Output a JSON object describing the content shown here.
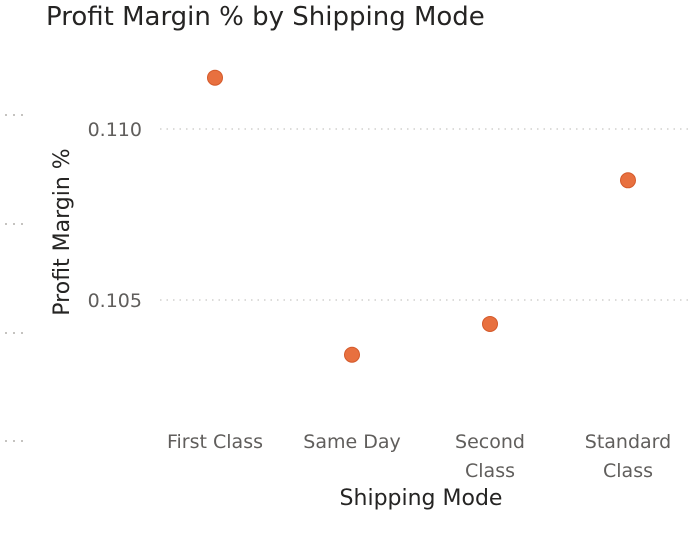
{
  "chart_data": {
    "type": "scatter",
    "title": "Profit Margin % by Shipping Mode",
    "xlabel": "Shipping Mode",
    "ylabel": "Profit Margin %",
    "categories": [
      "First Class",
      "Same Day",
      "Second Class",
      "Standard Class"
    ],
    "category_labels": [
      [
        "First Class"
      ],
      [
        "Same Day"
      ],
      [
        "Second",
        "Class"
      ],
      [
        "Standard",
        "Class"
      ]
    ],
    "values": [
      0.1115,
      0.1034,
      0.1043,
      0.1085
    ],
    "yticks": [
      0.105,
      0.11
    ],
    "ytick_labels": [
      "0.105",
      "0.110"
    ],
    "ylim": [
      0.1,
      0.113
    ],
    "grid": true,
    "marker_color": "#E8703F",
    "marker_stroke": "#D45A2B",
    "text_color": "#605E5C",
    "title_color": "#252423",
    "grid_color": "#C8C6C4"
  }
}
